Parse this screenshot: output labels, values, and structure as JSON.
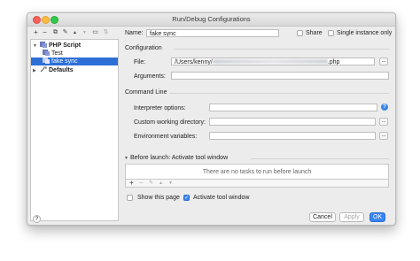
{
  "window": {
    "title": "Run/Debug Configurations"
  },
  "toolbar": {
    "items": [
      {
        "name": "add-icon",
        "glyph": "+"
      },
      {
        "name": "remove-icon",
        "glyph": "−"
      },
      {
        "name": "copy-icon",
        "glyph": "⧉"
      },
      {
        "name": "edit-defaults-icon",
        "glyph": "✎"
      },
      {
        "name": "move-up-icon",
        "glyph": "▲"
      },
      {
        "name": "move-down-icon",
        "glyph": "▼"
      },
      {
        "name": "folder-icon",
        "glyph": "▭"
      },
      {
        "name": "sort-icon",
        "glyph": "⇅"
      }
    ]
  },
  "tree": {
    "items": [
      {
        "label": "PHP Script",
        "level": 0,
        "expanded": true,
        "bold": true,
        "icon": "php-script-icon"
      },
      {
        "label": "Test",
        "level": 1,
        "icon": "php-config-icon"
      },
      {
        "label": "fake sync",
        "level": 1,
        "selected": true,
        "icon": "php-config-icon"
      },
      {
        "label": "Defaults",
        "level": 0,
        "expanded": false,
        "bold": true,
        "icon": "wrench-icon"
      }
    ]
  },
  "form": {
    "name_label": "Name:",
    "name_value": "fake sync",
    "share_label": "Share",
    "share_checked": false,
    "single_instance_label": "Single instance only",
    "single_instance_checked": false,
    "configuration_section": "Configuration",
    "file_label": "File:",
    "file_value_prefix": "/Users/kenny/",
    "file_value_suffix": ".php",
    "arguments_label": "Arguments:",
    "arguments_value": "",
    "command_line_section": "Command Line",
    "interpreter_options_label": "Interpreter options:",
    "interpreter_options_value": "",
    "custom_working_dir_label": "Custom working directory:",
    "custom_working_dir_value": "",
    "env_vars_label": "Environment variables:",
    "env_vars_value": "",
    "browse_label": "...",
    "help_glyph": "?"
  },
  "before_launch": {
    "title": "Before launch: Activate tool window",
    "empty_text": "There are no tasks to run before launch",
    "tools": [
      {
        "name": "add-task-icon",
        "glyph": "+"
      },
      {
        "name": "remove-task-icon",
        "glyph": "−"
      },
      {
        "name": "edit-task-icon",
        "glyph": "✎"
      },
      {
        "name": "task-up-icon",
        "glyph": "▲"
      },
      {
        "name": "task-down-icon",
        "glyph": "▼"
      }
    ],
    "show_page_label": "Show this page",
    "show_page_checked": false,
    "activate_tool_window_label": "Activate tool window",
    "activate_tool_window_checked": true
  },
  "footer": {
    "help_glyph": "?",
    "cancel_label": "Cancel",
    "apply_label": "Apply",
    "ok_label": "OK"
  },
  "colors": {
    "accent": "#3a86f0",
    "selection": "#2d6fd6",
    "window_bg": "#ececec"
  }
}
